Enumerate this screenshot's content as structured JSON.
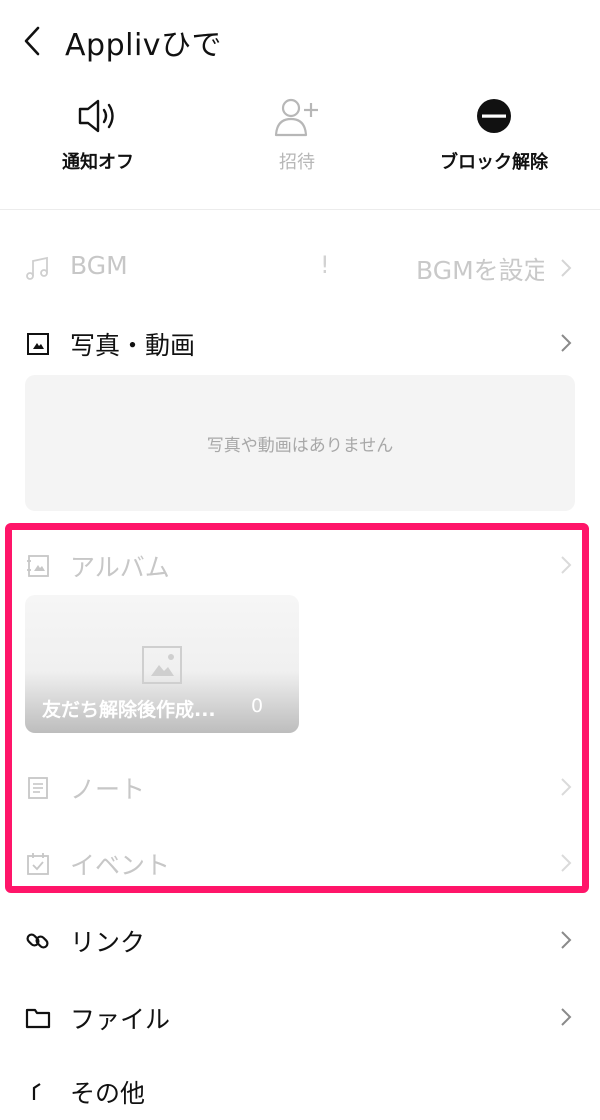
{
  "header": {
    "title": "Applivひで"
  },
  "actions": [
    {
      "label": "通知オフ",
      "icon": "speaker-icon"
    },
    {
      "label": "招待",
      "icon": "add-friend-icon"
    },
    {
      "label": "ブロック解除",
      "icon": "minus-circle-icon"
    }
  ],
  "rows": {
    "bgm": {
      "label": "BGM",
      "mark": "!",
      "value": "BGMを設定"
    },
    "photos": {
      "label": "写真・動画",
      "empty": "写真や動画はありません"
    },
    "album": {
      "label": "アルバム"
    },
    "note": {
      "label": "ノート"
    },
    "event": {
      "label": "イベント"
    },
    "link": {
      "label": "リンク"
    },
    "file": {
      "label": "ファイル"
    },
    "other": {
      "label": "その他"
    }
  },
  "album_card": {
    "title": "友だち解除後作成...",
    "count": "0"
  },
  "colors": {
    "highlight": "#ff1569",
    "dim_text": "#c7c7c7"
  }
}
